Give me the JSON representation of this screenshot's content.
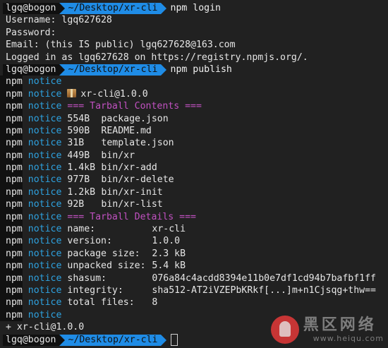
{
  "prompt": {
    "user_host": "lgq@bogon",
    "path": "~/Desktop/xr-cli"
  },
  "session": {
    "cmd_login": "npm login",
    "login_lines": [
      "Username: lgq627628",
      "Password:",
      "Email: (this IS public) lgq627628@163.com",
      "Logged in as lgq627628 on https://registry.npmjs.org/."
    ],
    "cmd_publish": "npm publish",
    "npm_prefix": "npm",
    "notice_label": "notice",
    "package_line": "xr-cli@1.0.0",
    "tarball_contents_header": "=== Tarball Contents ===",
    "files": [
      {
        "size": "554B",
        "name": "package.json"
      },
      {
        "size": "590B",
        "name": "README.md"
      },
      {
        "size": "31B",
        "name": "template.json"
      },
      {
        "size": "449B",
        "name": "bin/xr"
      },
      {
        "size": "1.4kB",
        "name": "bin/xr-add"
      },
      {
        "size": "977B",
        "name": "bin/xr-delete"
      },
      {
        "size": "1.2kB",
        "name": "bin/xr-init"
      },
      {
        "size": "92B",
        "name": "bin/xr-list"
      }
    ],
    "tarball_details_header": "=== Tarball Details ===",
    "details": [
      {
        "key": "name:",
        "value": "xr-cli"
      },
      {
        "key": "version:",
        "value": "1.0.0"
      },
      {
        "key": "package size:",
        "value": "2.3 kB"
      },
      {
        "key": "unpacked size:",
        "value": "5.4 kB"
      },
      {
        "key": "shasum:",
        "value": "076a84c4acdd8394e11b0e7df1cd94b7bafbf1ff"
      },
      {
        "key": "integrity:",
        "value": "sha512-AT2iVZEPbKRkf[...]m+n1Cjsqg+thw=="
      },
      {
        "key": "total files:",
        "value": "8"
      }
    ],
    "published_line": "+ xr-cli@1.0.0"
  },
  "watermark": {
    "logo_icon": "mushroom-logo-icon",
    "name": "黑区网络",
    "url": "www.heiqu.com"
  },
  "colors": {
    "background": "#212121",
    "path_segment": "#1f8ce6",
    "notice": "#2ea2e0",
    "header_magenta": "#c151c1"
  }
}
